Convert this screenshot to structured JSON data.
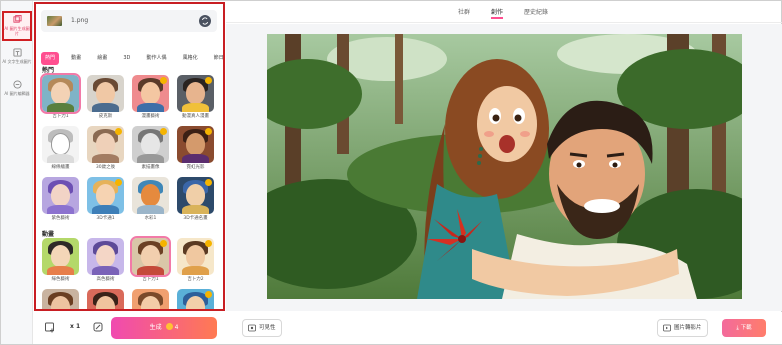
{
  "rail": {
    "items": [
      {
        "label": "AI 圖片生成圖片",
        "icon": "image-stack-icon",
        "active": true
      },
      {
        "label": "AI 文字生成圖片",
        "icon": "text-image-icon",
        "active": false
      },
      {
        "label": "AI 圖片編輯器",
        "icon": "image-edit-icon",
        "active": false
      }
    ]
  },
  "panel": {
    "file_name": "1.png",
    "categories": [
      "熱門",
      "動畫",
      "繪畫",
      "3D",
      "動作人偶",
      "風格化",
      "節日"
    ],
    "sections": [
      {
        "title": "熱門",
        "items": [
          {
            "label": "吉卜力1"
          },
          {
            "label": "皮克斯"
          },
          {
            "label": "漫畫藝術"
          },
          {
            "label": "動漫真人漫畫"
          },
          {
            "label": "線條繪畫"
          },
          {
            "label": "30歲之後"
          },
          {
            "label": "素描畫像"
          },
          {
            "label": "霓虹光影"
          },
          {
            "label": "紫色藝術"
          },
          {
            "label": "3D卡通1"
          },
          {
            "label": "水彩1"
          },
          {
            "label": "3D卡通名畫"
          }
        ]
      },
      {
        "title": "動畫",
        "items": [
          {
            "label": "綠色藝術"
          },
          {
            "label": "高色藝術"
          },
          {
            "label": "吉卜力1"
          },
          {
            "label": "吉卜力2"
          }
        ]
      }
    ]
  },
  "bottom_left": {
    "multiplier": "x 1",
    "generate_label": "生成",
    "generate_cost": "4"
  },
  "main": {
    "tabs": [
      {
        "label": "社群",
        "active": false
      },
      {
        "label": "創作",
        "active": true
      },
      {
        "label": "歷史紀錄",
        "active": false
      }
    ],
    "compare_label": "可見性",
    "convert_label": "圖片轉影片",
    "download_label": "下載"
  },
  "colors": {
    "accent": "#ff4f90",
    "highlight_border": "#c81e23",
    "generate_gradient_start": "#f04ab0",
    "generate_gradient_end": "#ff7a52"
  }
}
